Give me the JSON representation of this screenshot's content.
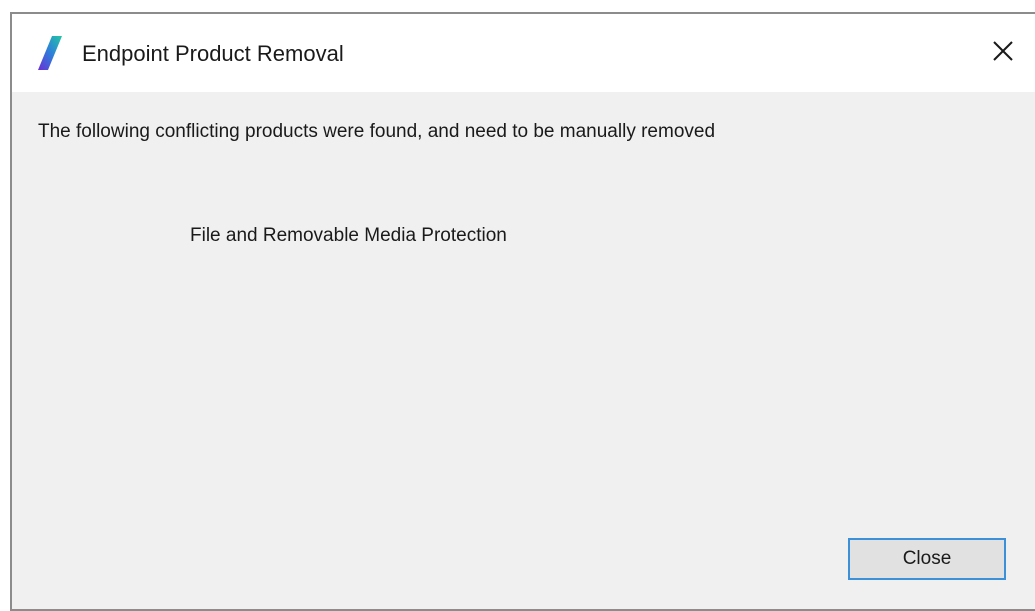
{
  "window": {
    "title": "Endpoint Product Removal",
    "close_glyph": "✕"
  },
  "dialog": {
    "message": "The following conflicting products were found, and need to be manually removed",
    "products": [
      "File and Removable Media Protection"
    ]
  },
  "buttons": {
    "close_label": "Close"
  },
  "icons": {
    "app_icon": "app-logo-icon",
    "window_close": "close-icon"
  },
  "colors": {
    "dialog_background": "#f0f0f0",
    "titlebar_background": "#ffffff",
    "button_focus_border": "#3c8fd9",
    "logo_gradient": [
      "#6b2fd6",
      "#2f7ddb",
      "#21c8a4"
    ]
  }
}
